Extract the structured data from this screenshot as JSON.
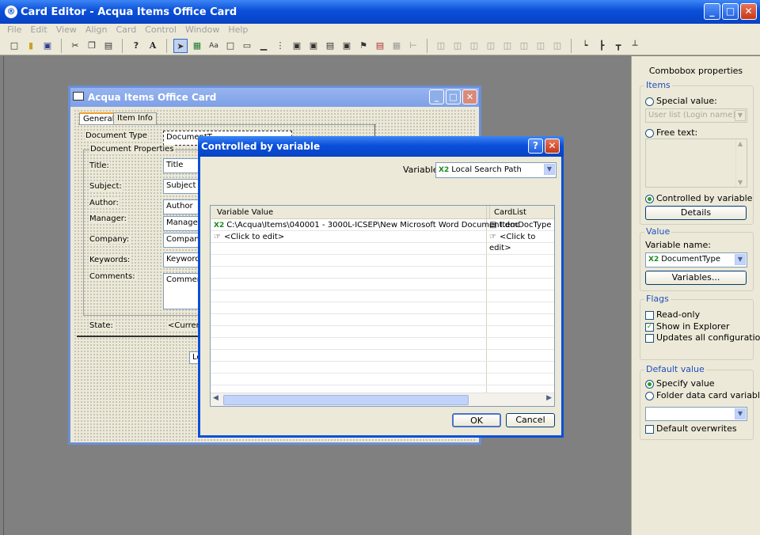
{
  "app": {
    "title": "Card Editor - Acqua Items Office Card",
    "icon_glyph": "®",
    "window_buttons": {
      "minimize": "_",
      "maximize": "□",
      "close": "✕"
    }
  },
  "menubar": [
    "File",
    "Edit",
    "View",
    "Align",
    "Card",
    "Control",
    "Window",
    "Help"
  ],
  "toolbar": {
    "icons": [
      "new-icon",
      "open-icon",
      "save-icon",
      "cut-icon",
      "copy-icon",
      "paste-icon",
      "help-icon",
      "font-icon",
      "pointer-icon",
      "image-icon",
      "label-icon",
      "frame-icon",
      "edit-icon",
      "line-icon",
      "combo-icon",
      "radio-icon",
      "checkbox-icon",
      "tab-icon",
      "group-icon",
      "flag-icon",
      "list-icon",
      "grid-icon",
      "tree-icon"
    ],
    "text_glyphs": {
      "help": "?",
      "font": "A",
      "label": "Aa"
    }
  },
  "form_window": {
    "title": "Acqua Items Office Card",
    "tabs": [
      "General",
      "Item Info"
    ],
    "document_type_label": "Document Type",
    "document_type_value": "DocumentT",
    "group_label": "Document Properties",
    "fields": [
      {
        "label": "Title:",
        "value": "Title"
      },
      {
        "label": "Subject:",
        "value": "Subject"
      },
      {
        "label": "Author:",
        "value": "Author"
      },
      {
        "label": "Manager:",
        "value": "Manager"
      },
      {
        "label": "Company:",
        "value": "Company"
      },
      {
        "label": "Keywords:",
        "value": "Keywords"
      },
      {
        "label": "Comments:",
        "value": "Comment"
      }
    ],
    "state_label": "State:",
    "state_value": "<Current s",
    "bottom_stub": "Lo"
  },
  "dialog": {
    "title": "Controlled by variable",
    "help_glyph": "?",
    "variable_label": "Variable",
    "variable_badge": "X2",
    "variable_value": "Local Search Path",
    "columns": [
      "Variable Value",
      "CardList"
    ],
    "rows": [
      {
        "badge": "X2",
        "value": "C:\\Acqua\\Items\\040001 - 3000L-ICSEP\\New Microsoft Word Document.doc",
        "cardlist": "ItemDocType"
      },
      {
        "badge": "☞",
        "value": "<Click to edit>",
        "cardlist": "<Click to edit>"
      }
    ],
    "ok_label": "OK",
    "cancel_label": "Cancel"
  },
  "props_panel": {
    "title": "Combobox properties",
    "items": {
      "label": "Items",
      "special_value_label": "Special value:",
      "special_value_placeholder": "User list (Login name)",
      "free_text_label": "Free text:",
      "controlled_label": "Controlled by variable",
      "details_button": "Details",
      "selected": "controlled"
    },
    "value": {
      "label": "Value",
      "variable_name_label": "Variable name:",
      "variable_badge": "X2",
      "variable_name": "DocumentType",
      "variables_button": "Variables..."
    },
    "flags": {
      "label": "Flags",
      "read_only_label": "Read-only",
      "read_only": false,
      "show_in_explorer_label": "Show in Explorer",
      "show_in_explorer": true,
      "updates_all_label": "Updates all configurations",
      "updates_all": false
    },
    "default_value": {
      "label": "Default value",
      "specify_label": "Specify value",
      "folder_label": "Folder data card variable",
      "selected": "specify",
      "combo_value": "",
      "default_overwrites_label": "Default overwrites",
      "default_overwrites": false
    }
  }
}
